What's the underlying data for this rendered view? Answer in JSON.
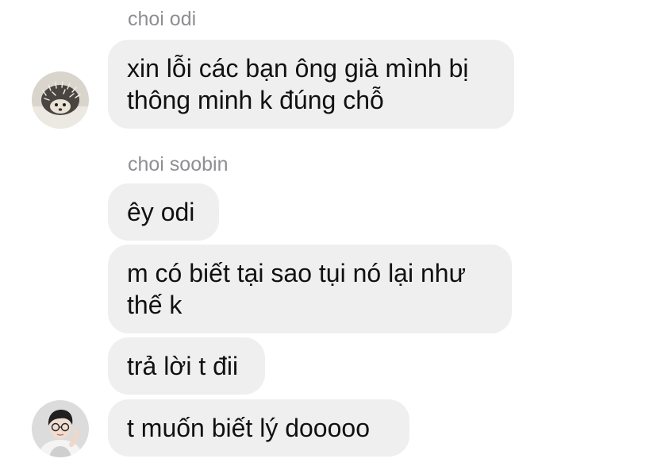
{
  "conversation": {
    "groups": [
      {
        "sender": "choi odi",
        "avatar_icon": "hedgehog-avatar",
        "messages": [
          "xin lỗi các bạn ông già mình bị thông minh k đúng chỗ"
        ]
      },
      {
        "sender": "choi soobin",
        "avatar_icon": "person-with-glasses-avatar",
        "messages": [
          "êy odi",
          "m có biết tại sao tụi nó lại như thế k",
          "trả lời t đii",
          "t muốn biết lý dooooo"
        ]
      }
    ]
  },
  "colors": {
    "bubble_bg": "#efefef",
    "sender_text": "#8e8e93",
    "message_text": "#111111"
  }
}
